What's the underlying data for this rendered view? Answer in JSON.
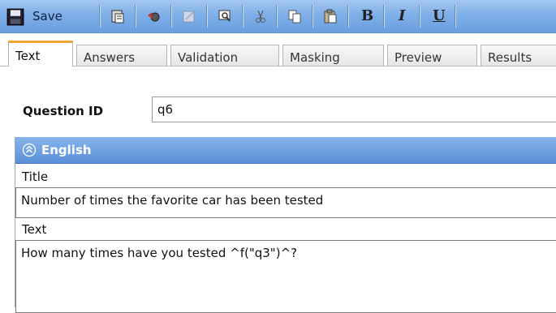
{
  "toolbar": {
    "save_label": "Save",
    "buttons": [
      "floppy-disk-icon",
      "paste-special-icon",
      "undo-icon",
      "edit-icon",
      "find-icon",
      "cut-icon",
      "copy-icon",
      "paste-icon",
      "bold-icon",
      "italic-icon",
      "underline-icon"
    ],
    "bold_glyph": "B",
    "italic_glyph": "I",
    "underline_glyph": "U"
  },
  "tabs": [
    "Text",
    "Answers",
    "Validation",
    "Masking",
    "Preview",
    "Results"
  ],
  "question": {
    "id_label": "Question ID",
    "id_value": "q6"
  },
  "section": {
    "title": "English",
    "title_label": "Title",
    "title_value": "Number of times the favorite car has been tested",
    "text_label": "Text",
    "text_value": "How many times have you tested ^f(\"q3\")^?"
  },
  "colors": {
    "toolbar_blue": "#7fafe8",
    "active_tab_accent": "#f0a43a",
    "section_header_blue": "#5c90d8"
  }
}
